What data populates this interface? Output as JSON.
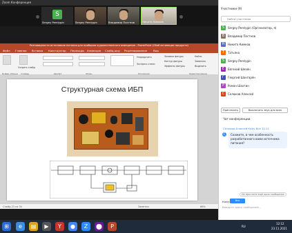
{
  "zoom": {
    "title": "Zoom Конференция"
  },
  "tiles": [
    {
      "name": "Sergey Perelygin",
      "letter": "S",
      "color": "#4caf50",
      "video": false
    },
    {
      "name": "Sergey Perelygin",
      "letter": "",
      "color": "",
      "video": true
    },
    {
      "name": "Владимир Постнов",
      "letter": "",
      "color": "",
      "video": true
    },
    {
      "name": "Никита Кимков",
      "letter": "",
      "color": "",
      "video": true
    }
  ],
  "powerpoint": {
    "window_title": "Разновидности источников питания для приборов художественного освещения - PowerPoint (Сбой активации продукта)",
    "tabs": [
      "Файл",
      "Главная",
      "Вставка",
      "Конструктор",
      "Переходы",
      "Анимация",
      "Слайд-шоу",
      "Рецензирование",
      "Вид"
    ],
    "ribbon": {
      "groups": [
        "Буфер обмена",
        "Слайды",
        "Шрифт",
        "Абзац",
        "Рисование",
        "Редактирование"
      ],
      "items": [
        "Создать слайд",
        "Упорядочить",
        "Экспресс-стили",
        "Заливка фигуры",
        "Контур фигуры",
        "Эффекты фигуры",
        "Найти",
        "Заменить",
        "Выделить"
      ]
    },
    "slide": {
      "title": "Структурная схема ИБП"
    },
    "status": {
      "left": "Слайд 21 из 34",
      "notes": "Заметки",
      "zoom": "66%"
    }
  },
  "participants_panel": {
    "title": "Участники (9)",
    "search_placeholder": "Найти участника",
    "items": [
      {
        "letter": "S",
        "color": "#4caf50",
        "name": "Sergey Perelygin (Организатор, я)"
      },
      {
        "letter": "В",
        "color": "#8d6e63",
        "name": "Владимир Постнов"
      },
      {
        "letter": "Н",
        "color": "#5c6bc0",
        "name": "Никита Кимков"
      },
      {
        "letter": "Т",
        "color": "#ef6c00",
        "name": "Татьяна"
      },
      {
        "letter": "S",
        "color": "#4caf50",
        "name": "Sergey Perelygin"
      },
      {
        "letter": "Е",
        "color": "#9c27b0",
        "name": "Евгений Шеэйн"
      },
      {
        "letter": "Г",
        "color": "#3f51b5",
        "name": "Георгий Шангарян"
      },
      {
        "letter": "Р",
        "color": "#ab47bc",
        "name": "Роман Шахтин"
      },
      {
        "letter": "С",
        "color": "#d84315",
        "name": "Селюков Алексей"
      }
    ],
    "buttons": {
      "invite": "Пригласить",
      "mute_all": "Выключить звук для всех"
    }
  },
  "chat": {
    "title": "Чат конференции",
    "sender": "Селюков Алексей Кому Все 12:11",
    "message": "Скажите, в чем особенность разработанного вами источника питания?",
    "unread": "Не прочтено ещё одно сообщение",
    "to_label": "Кому:",
    "to_value": "Все",
    "input_placeholder": "Введите здесь сообщение..."
  },
  "taskbar": {
    "lang": "RU",
    "time": "12:12",
    "date": "23.11.2021"
  }
}
